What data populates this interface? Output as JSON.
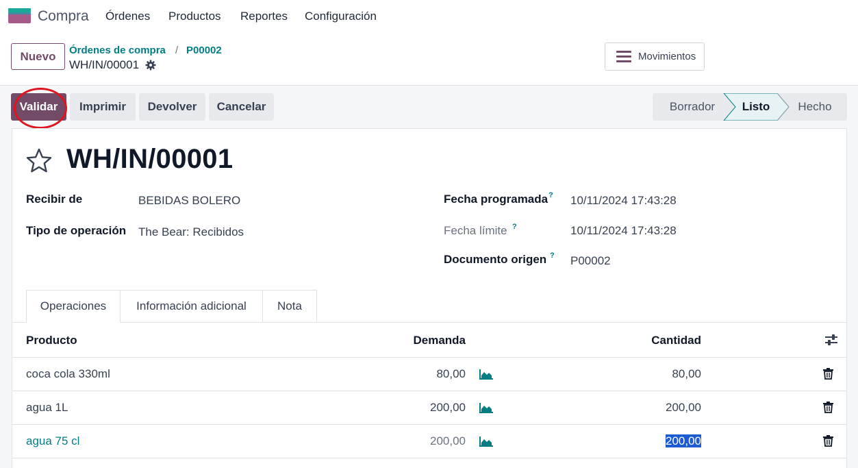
{
  "nav": {
    "app_name": "Compra",
    "menu": [
      "Órdenes",
      "Productos",
      "Reportes",
      "Configuración"
    ]
  },
  "control": {
    "new_button": "Nuevo",
    "breadcrumb": [
      "Órdenes de compra",
      "P00002"
    ],
    "breadcrumb_sep": "/",
    "current_record": "WH/IN/00001",
    "moves_button": "Movimientos"
  },
  "actions": [
    "Validar",
    "Imprimir",
    "Devolver",
    "Cancelar"
  ],
  "stages": {
    "items": [
      "Borrador",
      "Listo",
      "Hecho"
    ],
    "active": "Listo"
  },
  "record": {
    "title": "WH/IN/00001",
    "fields_left": [
      {
        "label": "Recibir de",
        "value": "BEBIDAS BOLERO"
      },
      {
        "label": "Tipo de operación",
        "value": "The Bear: Recibidos"
      }
    ],
    "fields_right": [
      {
        "label": "Fecha programada",
        "help": "?",
        "value": "10/11/2024 17:43:28"
      },
      {
        "label": "Fecha límite",
        "help": "?",
        "value": "10/11/2024 17:43:28"
      },
      {
        "label": "Documento origen",
        "help": "?",
        "value": "P00002"
      }
    ]
  },
  "tabs": [
    "Operaciones",
    "Información adicional",
    "Nota"
  ],
  "table": {
    "columns": [
      "Producto",
      "Demanda",
      "Cantidad"
    ],
    "rows": [
      {
        "product": "coca cola 330ml",
        "demand": "80,00",
        "quantity": "80,00"
      },
      {
        "product": "agua 1L",
        "demand": "200,00",
        "quantity": "200,00"
      },
      {
        "product": "agua 75 cl",
        "demand": "200,00",
        "quantity": "200,00"
      }
    ]
  },
  "colors": {
    "primary": "#714b67",
    "link": "#017e84",
    "annotation": "#e0141e",
    "selection": "#1c5bd1"
  },
  "icons": {
    "logo": "purchase-app-icon",
    "settings": "gear-icon",
    "menu": "hamburger-icon",
    "favorite": "star-icon",
    "forecast": "area-chart-icon",
    "delete": "trash-icon",
    "optional_columns": "sliders-icon"
  }
}
